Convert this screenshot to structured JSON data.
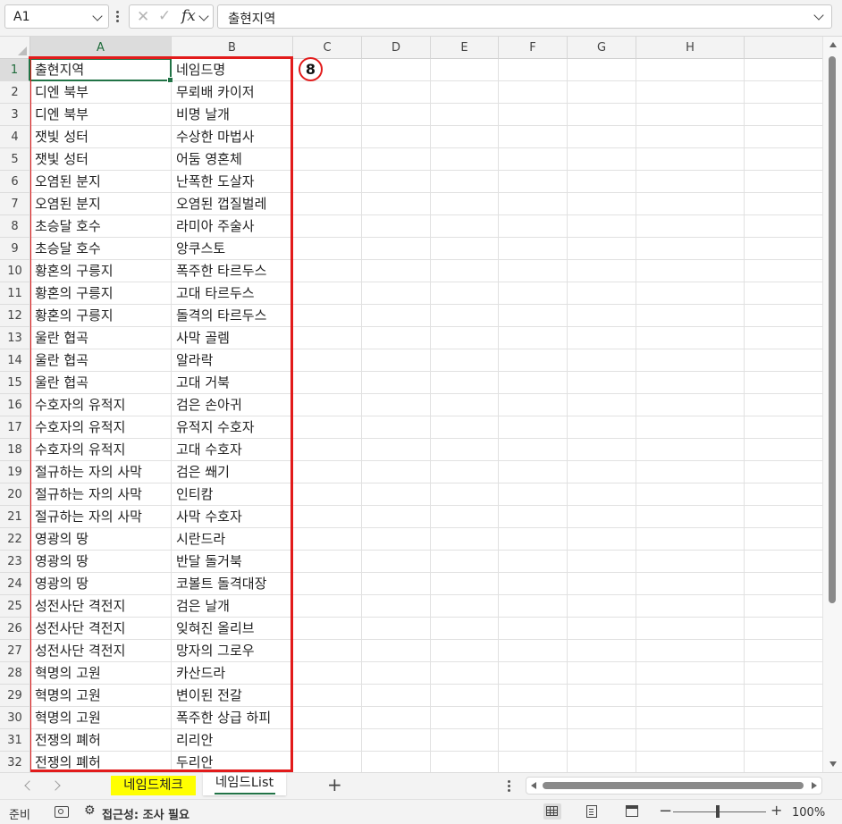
{
  "formula_bar": {
    "name_box": "A1",
    "cancel_icon": "✕",
    "enter_icon": "✓",
    "fx_label": "fx",
    "content": "출현지역"
  },
  "columns": [
    "A",
    "B",
    "C",
    "D",
    "E",
    "F",
    "G",
    "H"
  ],
  "selected_column": "A",
  "selected_row": 1,
  "rows": [
    {
      "n": 1,
      "a": "출현지역",
      "b": "네임드명"
    },
    {
      "n": 2,
      "a": "디엔 북부",
      "b": "무뢰배 카이저"
    },
    {
      "n": 3,
      "a": "디엔 북부",
      "b": "비명 날개"
    },
    {
      "n": 4,
      "a": "잿빛 성터",
      "b": "수상한 마법사"
    },
    {
      "n": 5,
      "a": "잿빛 성터",
      "b": "어둠 영혼체"
    },
    {
      "n": 6,
      "a": "오염된 분지",
      "b": "난폭한 도살자"
    },
    {
      "n": 7,
      "a": "오염된 분지",
      "b": "오염된 껍질벌레"
    },
    {
      "n": 8,
      "a": "초승달 호수",
      "b": "라미아 주술사"
    },
    {
      "n": 9,
      "a": "초승달 호수",
      "b": "앙쿠스토"
    },
    {
      "n": 10,
      "a": "황혼의 구릉지",
      "b": "폭주한 타르두스"
    },
    {
      "n": 11,
      "a": "황혼의 구릉지",
      "b": "고대 타르두스"
    },
    {
      "n": 12,
      "a": "황혼의 구릉지",
      "b": "돌격의 타르두스"
    },
    {
      "n": 13,
      "a": "울란 협곡",
      "b": "사막 골렘"
    },
    {
      "n": 14,
      "a": "울란 협곡",
      "b": "알라락"
    },
    {
      "n": 15,
      "a": "울란 협곡",
      "b": "고대 거북"
    },
    {
      "n": 16,
      "a": "수호자의 유적지",
      "b": "검은 손아귀"
    },
    {
      "n": 17,
      "a": "수호자의 유적지",
      "b": "유적지 수호자"
    },
    {
      "n": 18,
      "a": "수호자의 유적지",
      "b": "고대 수호자"
    },
    {
      "n": 19,
      "a": "절규하는 자의 사막",
      "b": "검은 쐐기"
    },
    {
      "n": 20,
      "a": "절규하는 자의 사막",
      "b": "인티캄"
    },
    {
      "n": 21,
      "a": "절규하는 자의 사막",
      "b": "사막 수호자"
    },
    {
      "n": 22,
      "a": "영광의 땅",
      "b": "시란드라"
    },
    {
      "n": 23,
      "a": "영광의 땅",
      "b": "반달 돌거북"
    },
    {
      "n": 24,
      "a": "영광의 땅",
      "b": "코볼트 돌격대장"
    },
    {
      "n": 25,
      "a": "성전사단 격전지",
      "b": "검은 날개"
    },
    {
      "n": 26,
      "a": "성전사단 격전지",
      "b": "잊혀진 올리브"
    },
    {
      "n": 27,
      "a": "성전사단 격전지",
      "b": "망자의 그로우"
    },
    {
      "n": 28,
      "a": "혁명의 고원",
      "b": "카산드라"
    },
    {
      "n": 29,
      "a": "혁명의 고원",
      "b": "변이된 전갈"
    },
    {
      "n": 30,
      "a": "혁명의 고원",
      "b": "폭주한 상급 하피"
    },
    {
      "n": 31,
      "a": "전쟁의 폐허",
      "b": "리리안"
    },
    {
      "n": 32,
      "a": "전쟁의 폐허",
      "b": "두리안"
    }
  ],
  "annotation": {
    "callout_number": "8",
    "highlight_color": "#e21b1b"
  },
  "sheet_tabs": {
    "tabs": [
      {
        "label": "네임드체크",
        "highlight": "#ffff00"
      },
      {
        "label": "네임드List",
        "active": true
      }
    ],
    "add_label": "+"
  },
  "status_bar": {
    "ready": "준비",
    "accessibility": "접근성: 조사 필요",
    "zoom_minus": "−",
    "zoom_plus": "+",
    "zoom": "100%"
  },
  "colors": {
    "accent": "#217346",
    "annotation": "#e21b1b",
    "tab_highlight": "#ffff00"
  }
}
